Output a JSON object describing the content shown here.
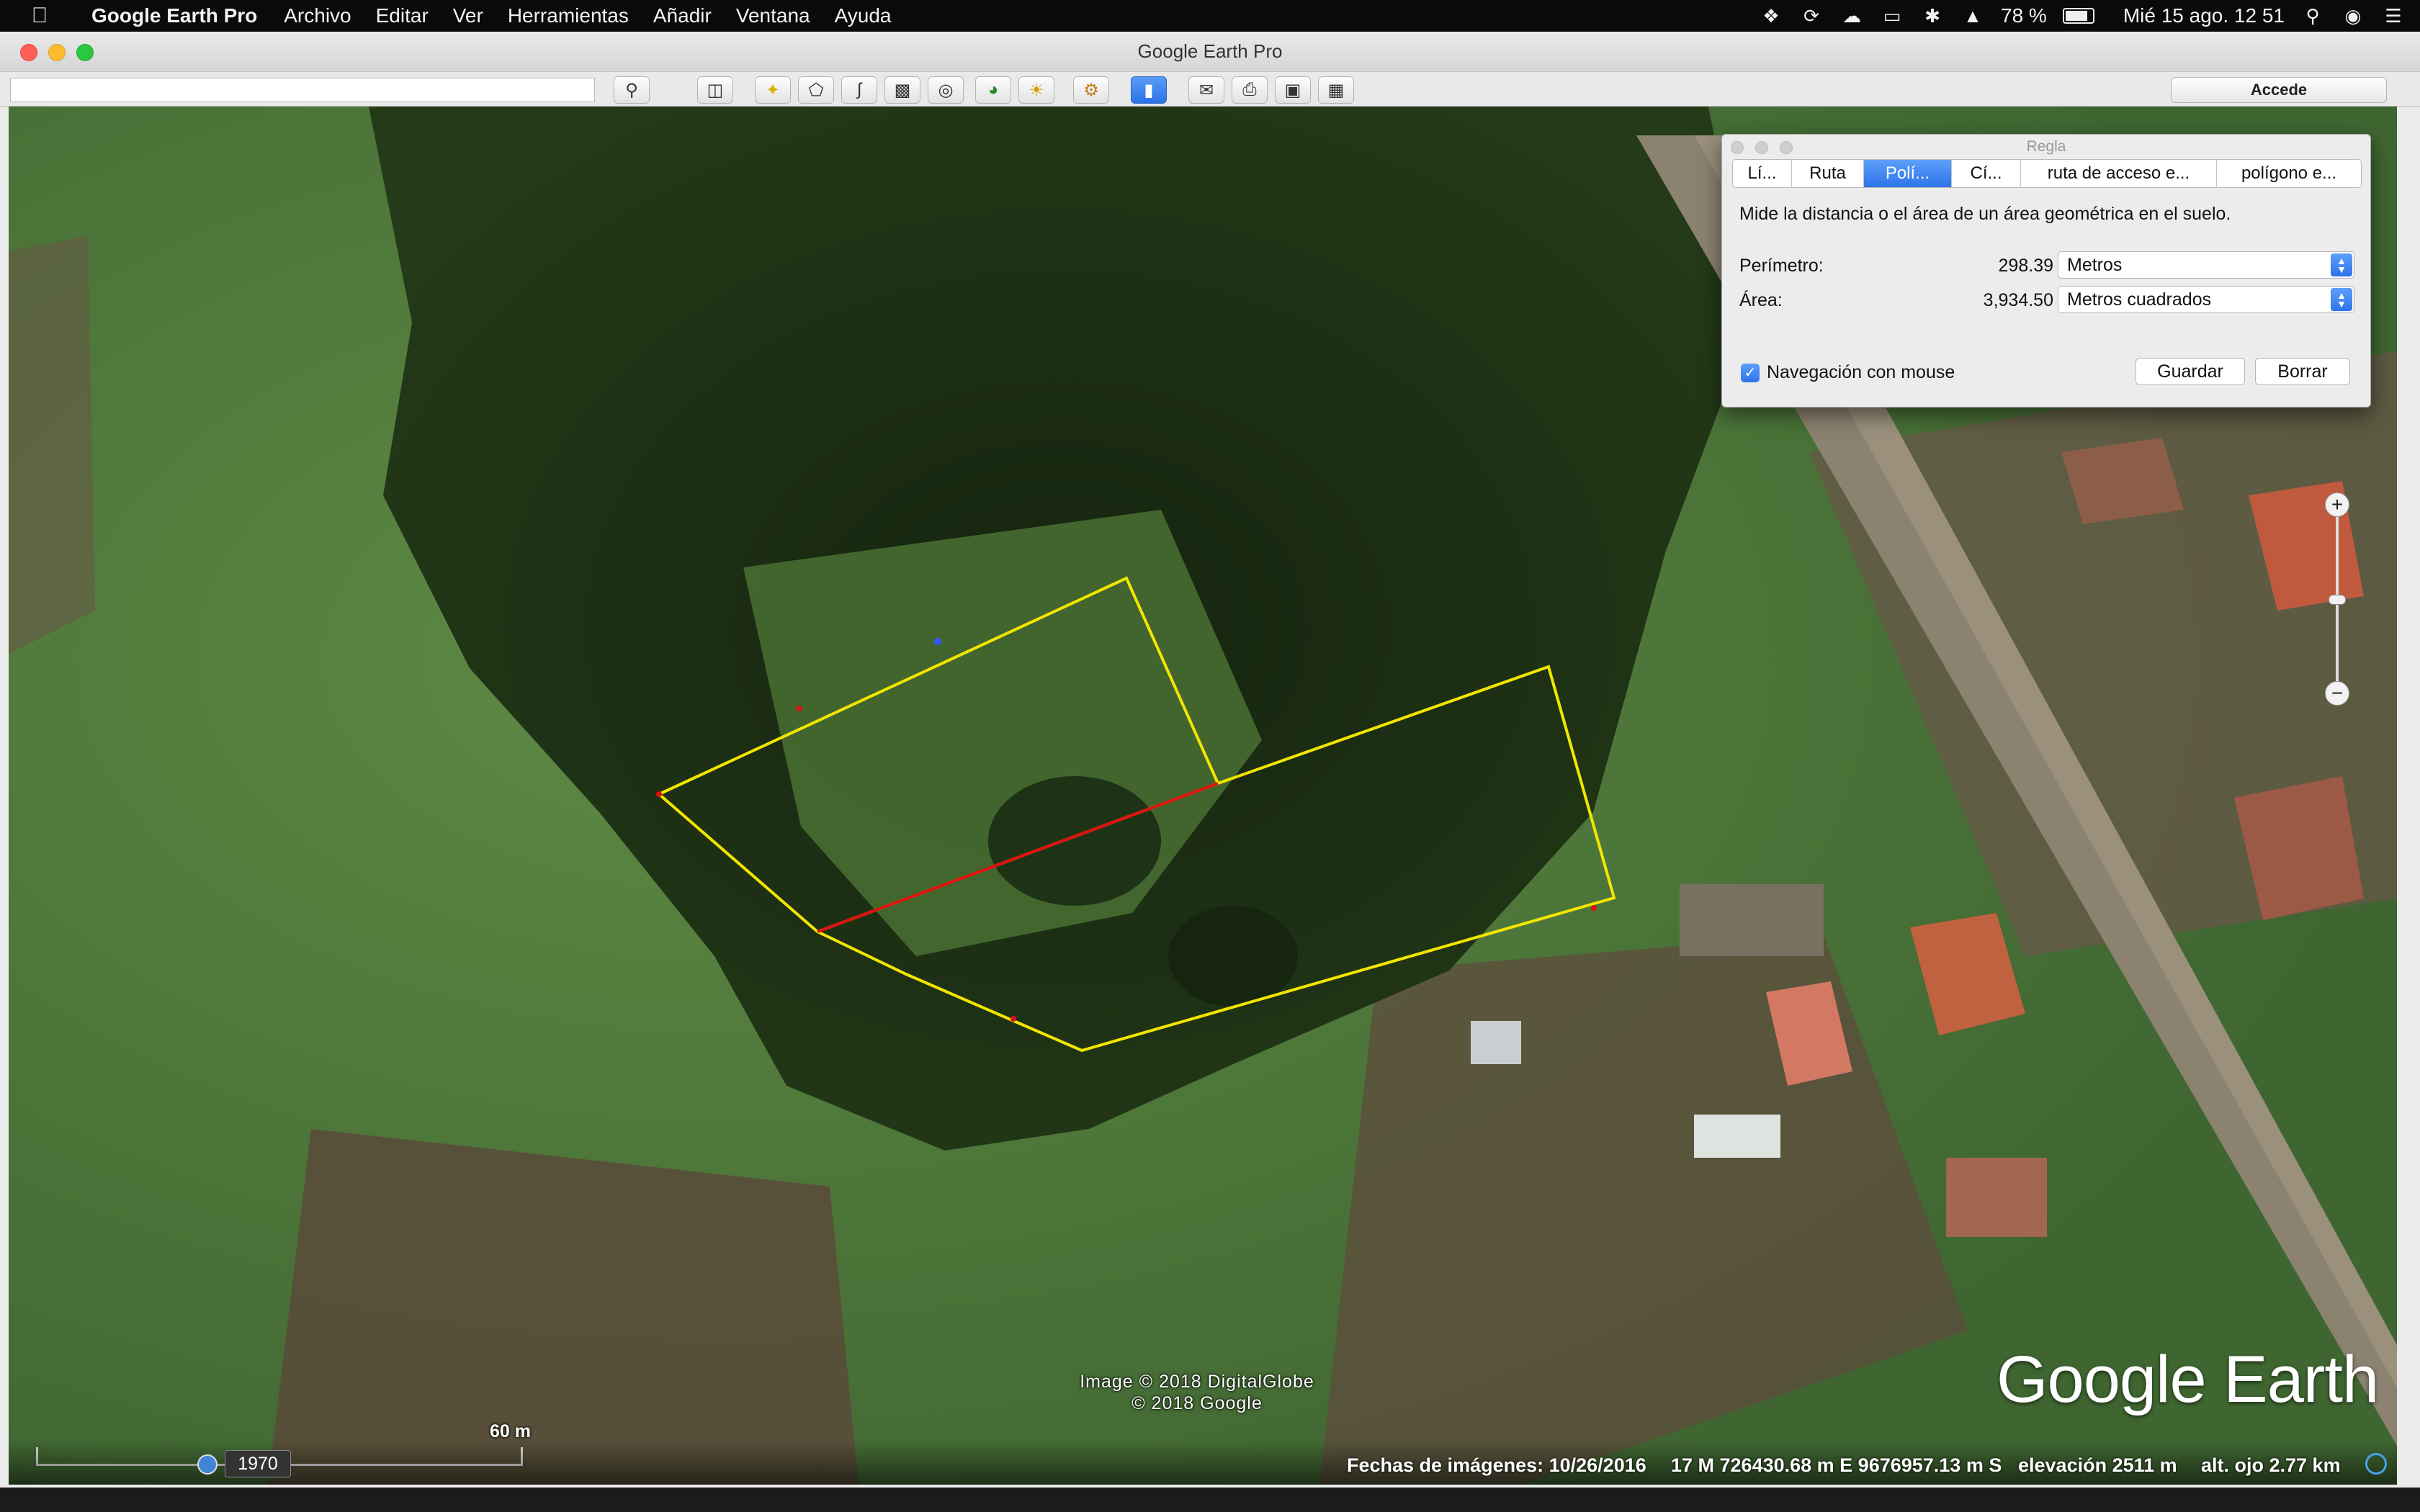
{
  "menubar": {
    "app_name": "Google Earth Pro",
    "items": [
      "Archivo",
      "Editar",
      "Ver",
      "Herramientas",
      "Añadir",
      "Ventana",
      "Ayuda"
    ],
    "battery": "78 %",
    "clock": "Mié 15 ago.  12 51"
  },
  "window": {
    "title": "Google Earth Pro"
  },
  "toolbar": {
    "search_value": "",
    "login_label": "Accede"
  },
  "map": {
    "imagery_credit_line1": "Image © 2018 DigitalGlobe",
    "imagery_credit_line2": "© 2018 Google",
    "scale_label": "60 m",
    "logo": "Google Earth"
  },
  "statusbar": {
    "year": "1970",
    "imagery_date": "Fechas de imágenes: 10/26/2016",
    "coordinates": "17 M 726430.68 m E 9676957.13 m S",
    "elevation": "elevación  2511 m",
    "eye_altitude": "alt. ojo  2.77 km"
  },
  "ruler": {
    "title": "Regla",
    "tabs": [
      {
        "label": "Lí...",
        "active": false
      },
      {
        "label": "Ruta",
        "active": false
      },
      {
        "label": "Polí...",
        "active": true
      },
      {
        "label": "Cí...",
        "active": false
      },
      {
        "label": "ruta de acceso e...",
        "active": false
      },
      {
        "label": "polígono e...",
        "active": false
      }
    ],
    "description": "Mide la distancia o el área de un área geométrica en el suelo.",
    "perimeter_label": "Perímetro:",
    "perimeter_value": "298.39",
    "perimeter_unit": "Metros",
    "area_label": "Área:",
    "area_value": "3,934.50",
    "area_unit": "Metros cuadrados",
    "mouse_nav_label": "Navegación con mouse",
    "mouse_nav_checked": true,
    "save_label": "Guardar",
    "clear_label": "Borrar"
  },
  "colors": {
    "polygon_outline": "#f2e600",
    "shared_edge": "#e01010",
    "accent": "#2d74ea"
  }
}
